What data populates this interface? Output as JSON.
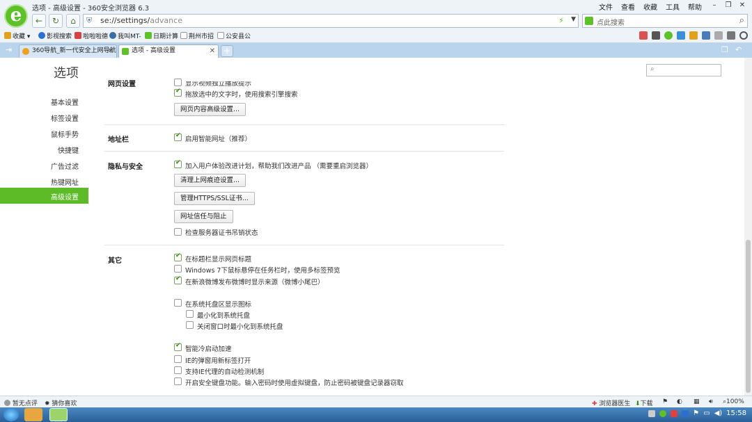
{
  "window": {
    "title": "选项 - 高级设置 - 360安全浏览器 6.3",
    "menu": [
      "文件",
      "查看",
      "收藏",
      "工具",
      "帮助"
    ],
    "controls": [
      "最小化",
      "还原",
      "关闭"
    ]
  },
  "nav": {
    "url_main": "se://settings/",
    "url_dim": "advance",
    "search_placeholder": "点此搜索"
  },
  "bookmarks": [
    {
      "label": "收藏",
      "color": "#e0a020"
    },
    {
      "label": "影视搜索",
      "color": "#2b6fd1"
    },
    {
      "label": "啦啦啦德",
      "color": "#d94040"
    },
    {
      "label": "我叫MT-",
      "color": "#3a6ea5"
    },
    {
      "label": "日期计算",
      "color": "#5ec12a"
    },
    {
      "label": "荆州市招",
      "color": "#999999"
    },
    {
      "label": "公安县公",
      "color": "#999999"
    }
  ],
  "tabs": [
    {
      "label": "360导航_新一代安全上网导航",
      "active": false
    },
    {
      "label": "选项 - 高级设置",
      "active": true
    }
  ],
  "page": {
    "title": "选项",
    "sidebar": [
      "基本设置",
      "标签设置",
      "鼠标手势",
      "快捷键",
      "广告过滤",
      "热键网址",
      "高级设置"
    ],
    "active_item": "高级设置",
    "sections": {
      "webpage": {
        "label": "网页设置",
        "options": [
          {
            "label": "显示视频独立播放提示",
            "checked": false
          },
          {
            "label": "拖放选中的文字时，使用搜索引擎搜索",
            "checked": true
          }
        ],
        "button": "网页内容高级设置..."
      },
      "address": {
        "label": "地址栏",
        "options": [
          {
            "label": "启用智能网址（推荐）",
            "checked": true
          }
        ]
      },
      "privacy": {
        "label": "隐私与安全",
        "options": [
          {
            "label": "加入用户体验改进计划，帮助我们改进产品 （需要重启浏览器）",
            "checked": true
          },
          {
            "label": "检查服务器证书吊销状态",
            "checked": false
          }
        ],
        "buttons": [
          "清理上网痕迹设置...",
          "管理HTTPS/SSL证书...",
          "网址信任与阻止"
        ]
      },
      "other": {
        "label": "其它",
        "options": [
          {
            "label": "在标题栏显示网页标题",
            "checked": true
          },
          {
            "label": "Windows 7下鼠标悬停在任务栏时，使用多标签预览",
            "checked": false
          },
          {
            "label": "在新浪微博发布微博时显示来源（微博小尾巴）",
            "checked": true
          },
          {
            "label": "在系统托盘区显示图标",
            "checked": false
          },
          {
            "label": "最小化到系统托盘",
            "checked": false
          },
          {
            "label": "关闭窗口时最小化到系统托盘",
            "checked": false
          },
          {
            "label": "智能冷启动加速",
            "checked": true
          },
          {
            "label": "IE的弹窗用新标签打开",
            "checked": false
          },
          {
            "label": "支持IE代理的自动检测机制",
            "checked": false
          },
          {
            "label": "开启安全键盘功能。输入密码时使用虚拟键盘，防止密码被键盘记录器窃取",
            "checked": false
          }
        ]
      }
    }
  },
  "status": {
    "left1": "暂无点评",
    "left2": "猜你喜欢",
    "doctor": "浏览器医生",
    "download": "下载",
    "zoom": "100%"
  },
  "taskbar": {
    "time": "15:58"
  },
  "colors": {
    "accent": "#5cbb27",
    "chrome": "#eef3f8",
    "tabbar": "#b9d4ec"
  }
}
